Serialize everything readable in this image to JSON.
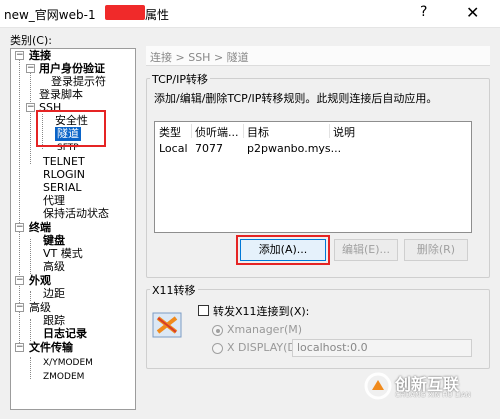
{
  "window": {
    "title_left": "new_官网web-1",
    "title_right": "属性",
    "help_label": "?",
    "close_label": "✕"
  },
  "category_label": "类别(C):",
  "tree": {
    "nodes": [
      {
        "label": "连接",
        "bold": true
      },
      {
        "label": "用户身份验证",
        "bold": true
      },
      {
        "label": "登录提示符"
      },
      {
        "label": "登录脚本"
      },
      {
        "label": "SSH"
      },
      {
        "label": "安全性"
      },
      {
        "label": "隧道",
        "selected": true
      },
      {
        "label": "SFTP"
      },
      {
        "label": "TELNET"
      },
      {
        "label": "RLOGIN"
      },
      {
        "label": "SERIAL"
      },
      {
        "label": "代理"
      },
      {
        "label": "保持活动状态"
      },
      {
        "label": "终端",
        "bold": true
      },
      {
        "label": "键盘",
        "bold": true
      },
      {
        "label": "VT 模式"
      },
      {
        "label": "高级"
      },
      {
        "label": "外观",
        "bold": true
      },
      {
        "label": "边距"
      },
      {
        "label": "高级"
      },
      {
        "label": "跟踪"
      },
      {
        "label": "日志记录",
        "bold": true
      },
      {
        "label": "文件传输",
        "bold": true
      },
      {
        "label": "X/YMODEM"
      },
      {
        "label": "ZMODEM"
      }
    ]
  },
  "breadcrumb": "连接 > SSH > 隧道",
  "tcpip": {
    "group_title": "TCP/IP转移",
    "description": "添加/编辑/删除TCP/IP转移规则。此规则连接后自动应用。",
    "columns": [
      "类型",
      "侦听端...",
      "目标",
      "说明"
    ],
    "rows": [
      {
        "type": "Local",
        "port": "7077",
        "target": "p2pwanbo.mys...",
        "desc": ""
      }
    ],
    "add_button": "添加(A)...",
    "edit_button": "编辑(E)...",
    "delete_button": "删除(R)"
  },
  "x11": {
    "group_title": "X11转移",
    "checkbox_label": "转发X11连接到(X):",
    "radio_xmanager": "Xmanager(M)",
    "radio_xdisplay": "X DISPLAY(D):",
    "display_value": "localhost:0.0"
  },
  "watermark": {
    "text": "创新互联",
    "sub": "CHUANG XIN HU LIAN"
  },
  "colors": {
    "selection": "#0a64c8",
    "annotation_red": "#e52424",
    "accent_blue": "#0078d7"
  }
}
